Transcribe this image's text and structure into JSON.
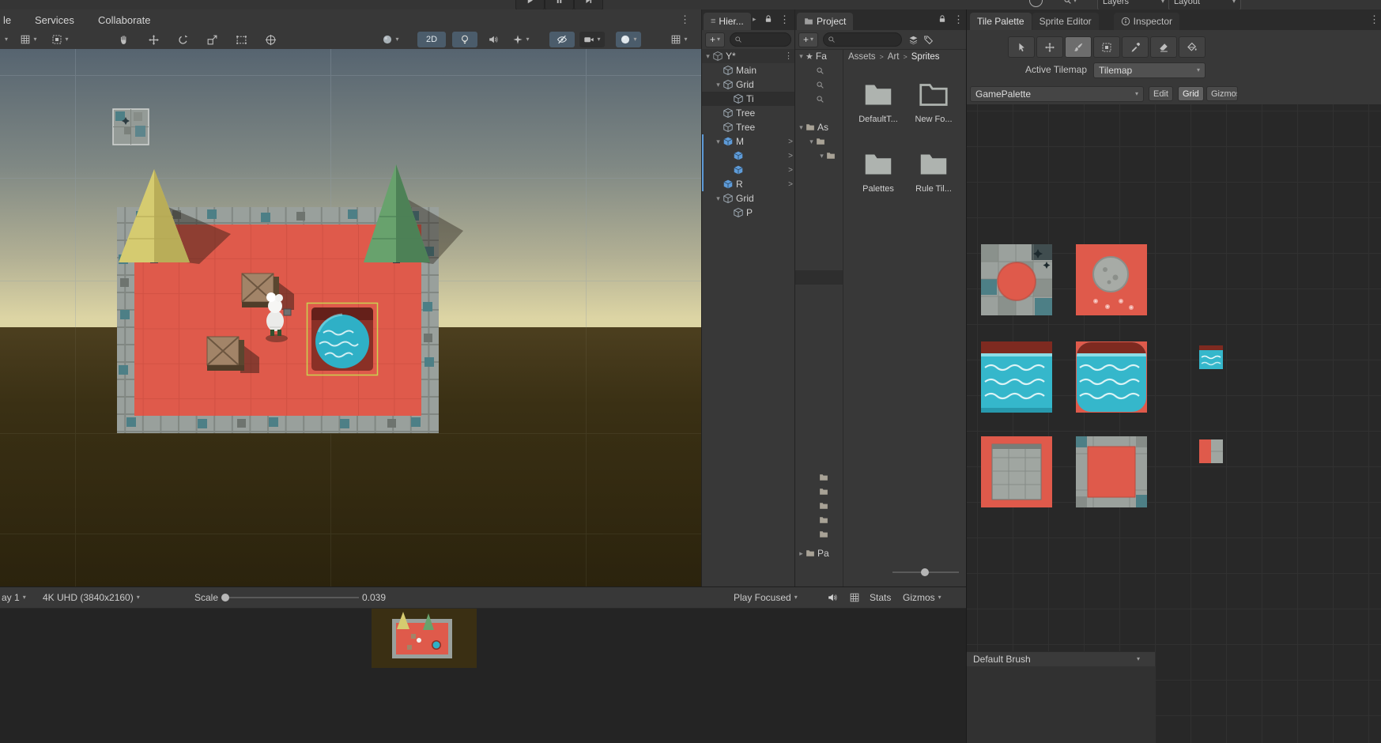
{
  "icons": {
    "kebab": "⋮",
    "chevron_down": "▾",
    "chevron_right": "▸",
    "arrow_right": ">",
    "menu": "≡",
    "star": "★",
    "plus": "+",
    "crumb_sep": ">"
  },
  "menubar": {
    "items": [
      "le",
      "Services",
      "Collaborate"
    ]
  },
  "top_right": {
    "layers_label": "Layers",
    "layout_label": "Layout"
  },
  "scene_toolbar": {
    "mode_2d": "2D"
  },
  "hierarchy": {
    "tab_label": "Hier...",
    "rows": [
      {
        "label": "Y*"
      },
      {
        "label": "Main"
      },
      {
        "label": "Grid"
      },
      {
        "label": "Ti"
      },
      {
        "label": "Tree"
      },
      {
        "label": "Tree"
      },
      {
        "label": "M"
      },
      {
        "label": ""
      },
      {
        "label": ""
      },
      {
        "label": "R"
      },
      {
        "label": "Grid"
      },
      {
        "label": "P"
      }
    ]
  },
  "project": {
    "tab_label": "Project",
    "breadcrumb": {
      "root": "Assets",
      "mid": "Art",
      "leaf": "Sprites"
    },
    "tree": {
      "favorites": "Fa",
      "assets": "As",
      "packages": "Pa"
    },
    "folders": [
      {
        "name": "DefaultT..."
      },
      {
        "name": "New Fo..."
      },
      {
        "name": "Palettes"
      },
      {
        "name": "Rule Til..."
      }
    ]
  },
  "tile_palette": {
    "tabs": [
      {
        "label": "Tile Palette"
      },
      {
        "label": "Sprite Editor"
      },
      {
        "label": "Inspector"
      }
    ],
    "active_tilemap_label": "Active Tilemap",
    "active_tilemap_value": "Tilemap",
    "palette_value": "GamePalette",
    "edit_label": "Edit",
    "grid_label": "Grid",
    "gizmos_label": "Gizmos",
    "brush_value": "Default Brush"
  },
  "game_bar": {
    "display_value": "ay 1",
    "resolution_value": "4K UHD (3840x2160)",
    "scale_label": "Scale",
    "scale_value": "0.039",
    "focus_value": "Play Focused",
    "stats_label": "Stats",
    "gizmos_label": "Gizmos"
  },
  "colors": {
    "floor_red": "#df5a4b",
    "water_teal": "#35b7cb",
    "prefab_blue": "#5e9bd8",
    "selection_green": "#c9d24f"
  }
}
